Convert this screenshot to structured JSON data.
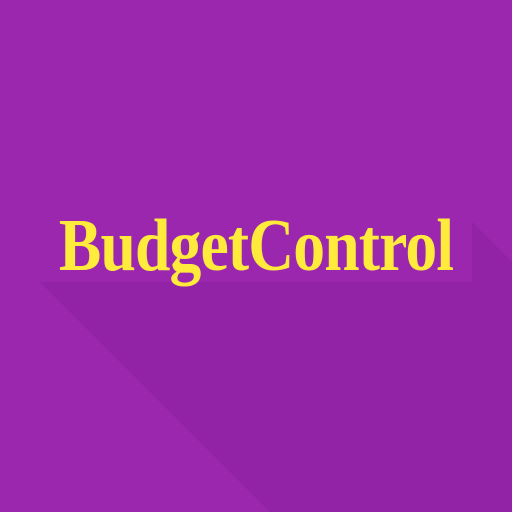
{
  "app": {
    "name": "BudgetControl"
  },
  "colors": {
    "background": "#9b27af",
    "shadow": "#8a1f9e",
    "text": "#ffeb3b"
  }
}
